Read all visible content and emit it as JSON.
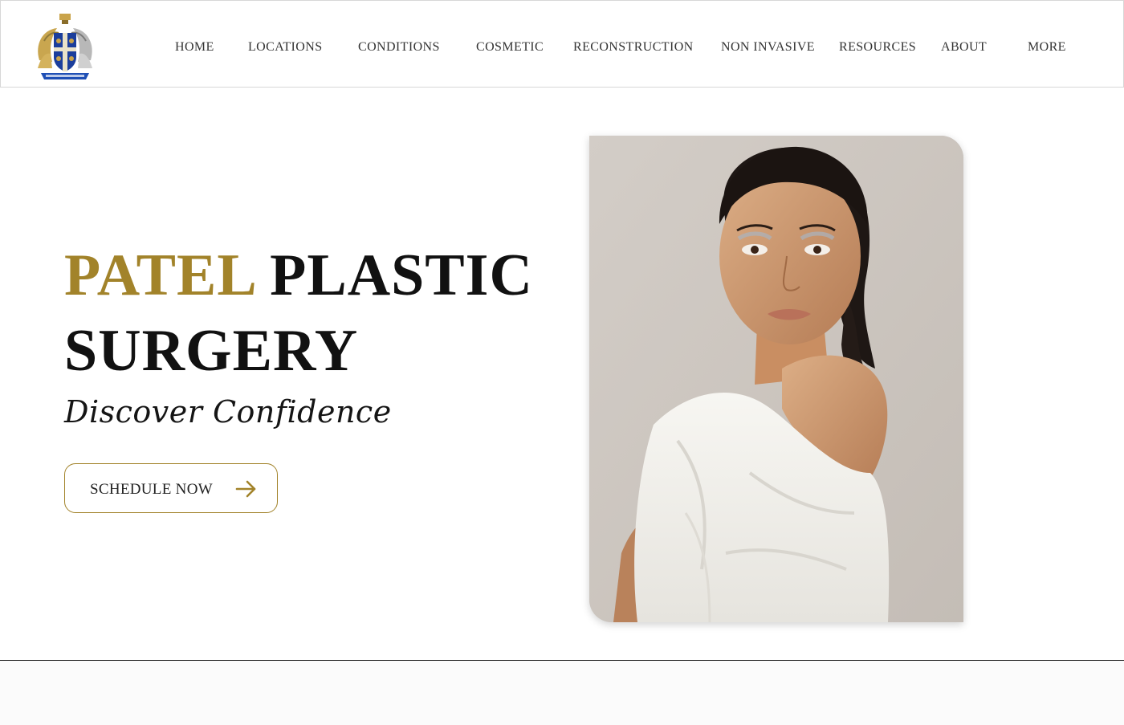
{
  "nav": {
    "items": [
      {
        "label": "HOME"
      },
      {
        "label": "LOCATIONS"
      },
      {
        "label": "CONDITIONS"
      },
      {
        "label": "COSMETIC"
      },
      {
        "label": "RECONSTRUCTION"
      },
      {
        "label": "NON INVASIVE"
      },
      {
        "label": "RESOURCES"
      },
      {
        "label": "ABOUT"
      },
      {
        "label": "MORE"
      }
    ]
  },
  "logo": {
    "icon": "coat-of-arms-icon"
  },
  "hero": {
    "title_accent": "PATEL",
    "title_rest": "PLASTIC",
    "title_line2": "SURGERY",
    "tagline": "Discover Confidence",
    "cta_label": "SCHEDULE NOW",
    "cta_icon": "arrow-right-icon",
    "photo": "model-portrait-image"
  },
  "colors": {
    "accent_gold": "#a2832a",
    "text_dark": "#111111",
    "header_border": "#d7d7d7",
    "photo_background": "#cdc7c1"
  }
}
